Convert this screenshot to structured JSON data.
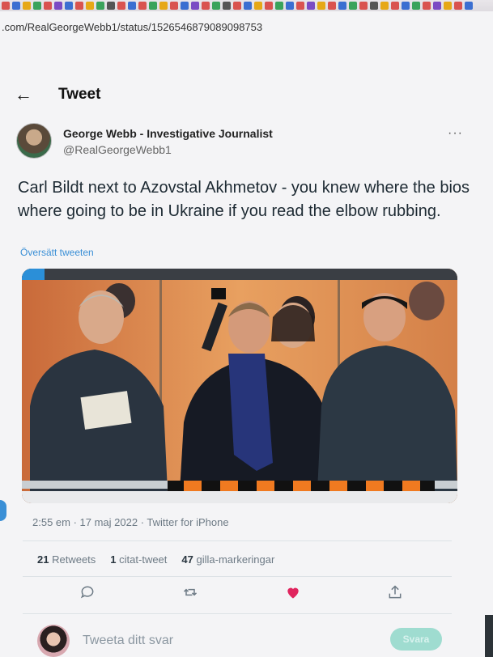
{
  "browser": {
    "url": ".com/RealGeorgeWebb1/status/1526546879089098753",
    "tab_icon_colors": [
      "#d9534f",
      "#3b6fd1",
      "#e6a817",
      "#3aa35b",
      "#d9534f",
      "#7b4bc4",
      "#3b6fd1",
      "#d9534f",
      "#e6a817",
      "#3aa35b",
      "#555555",
      "#d9534f",
      "#3b6fd1",
      "#d9534f",
      "#3aa35b",
      "#e6a817",
      "#d9534f",
      "#3b6fd1",
      "#7b4bc4",
      "#d9534f",
      "#3aa35b",
      "#555555",
      "#d9534f",
      "#3b6fd1",
      "#e6a817",
      "#d9534f",
      "#3aa35b",
      "#3b6fd1",
      "#d9534f",
      "#7b4bc4",
      "#e6a817",
      "#d9534f",
      "#3b6fd1",
      "#3aa35b",
      "#d9534f",
      "#555555",
      "#e6a817",
      "#d9534f",
      "#3b6fd1",
      "#3aa35b",
      "#d9534f",
      "#7b4bc4",
      "#e6a817",
      "#d9534f",
      "#3b6fd1"
    ]
  },
  "header": {
    "back_icon": "arrow-left-icon",
    "title": "Tweet"
  },
  "author": {
    "name": "George Webb - Investigative Journalist",
    "handle": "@RealGeorgeWebb1",
    "more_icon": "more-horizontal-icon"
  },
  "tweet": {
    "text": "Carl Bildt next to Azovstal Akhmetov - you knew where the bios where going to be in Ukraine if you read the elbow rubbing.",
    "translate_label": "Översätt tweeten",
    "timestamp": "2:55 em · 17 maj 2022 · Twitter for iPhone"
  },
  "stats": {
    "retweets_count": "21",
    "retweets_label": "Retweets",
    "quotes_count": "1",
    "quotes_label": "citat-tweet",
    "likes_count": "47",
    "likes_label": "gilla-markeringar"
  },
  "actions": {
    "reply_icon": "reply-icon",
    "retweet_icon": "retweet-icon",
    "like_icon": "heart-icon",
    "share_icon": "share-icon",
    "like_color": "#e0245e"
  },
  "reply": {
    "placeholder": "Tweeta ditt svar",
    "button_label": "Svara"
  }
}
